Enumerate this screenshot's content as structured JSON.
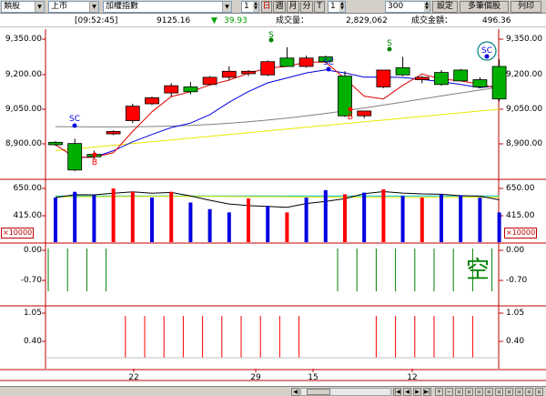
{
  "toolbar": {
    "category": "類股",
    "market": "上市",
    "index_name": "加權指數",
    "period_value": "1",
    "period_buttons": [
      "日",
      "週",
      "月",
      "分",
      "T"
    ],
    "period_active": "日",
    "count_value": "1",
    "bars_value": "300",
    "settings_label": "設定",
    "multi_label": "多筆個股",
    "list_label": "列印"
  },
  "infobar": {
    "time": "[09:52:45]",
    "price": "9125.16",
    "change_arrow": "▼",
    "change": "39.93",
    "volume_label": "成交量：",
    "volume": "2,829,062",
    "amount_label": "成交金額：",
    "amount": "496.36"
  },
  "axes": {
    "price_ticks": [
      "9,350.00",
      "9,200.00",
      "9,050.00",
      "8,900.00"
    ],
    "volume_ticks": [
      "650.00",
      "415.00"
    ],
    "volume_unit": "×10000",
    "osc1_ticks": [
      "0.00",
      "-0.70"
    ],
    "osc2_ticks": [
      "1.05",
      "0.40"
    ],
    "x_ticks": [
      "22",
      "29",
      "15",
      "12"
    ],
    "osc_mark": "空"
  },
  "signals": {
    "sc": "SC",
    "b": "B",
    "s": "S"
  },
  "colors": {
    "up": "#ff0000",
    "down": "#00b000",
    "ma_short": "#e00000",
    "ma_mid": "#0000e0",
    "ma_long": "#808080",
    "ma_yellow": "#e8e800",
    "vol_blue": "#0000e0",
    "vol_red": "#ff0000",
    "axis": "#c00000"
  },
  "chart_data": {
    "type": "candlestick",
    "y_range": [
      8800,
      9420
    ],
    "candles": [
      {
        "o": 8950,
        "h": 8955,
        "l": 8935,
        "c": 8940
      },
      {
        "o": 8945,
        "h": 8965,
        "l": 8830,
        "c": 8835
      },
      {
        "o": 8900,
        "h": 8915,
        "l": 8880,
        "c": 8890
      },
      {
        "o": 8985,
        "h": 9000,
        "l": 8980,
        "c": 8995
      },
      {
        "o": 9040,
        "h": 9110,
        "l": 9030,
        "c": 9100
      },
      {
        "o": 9110,
        "h": 9140,
        "l": 9105,
        "c": 9135
      },
      {
        "o": 9155,
        "h": 9195,
        "l": 9140,
        "c": 9185
      },
      {
        "o": 9180,
        "h": 9200,
        "l": 9150,
        "c": 9160
      },
      {
        "o": 9190,
        "h": 9225,
        "l": 9185,
        "c": 9220
      },
      {
        "o": 9220,
        "h": 9265,
        "l": 9210,
        "c": 9245
      },
      {
        "o": 9235,
        "h": 9250,
        "l": 9225,
        "c": 9245
      },
      {
        "o": 9230,
        "h": 9290,
        "l": 9225,
        "c": 9285
      },
      {
        "o": 9300,
        "h": 9345,
        "l": 9265,
        "c": 9265
      },
      {
        "o": 9265,
        "h": 9310,
        "l": 9260,
        "c": 9300
      },
      {
        "o": 9305,
        "h": 9310,
        "l": 9280,
        "c": 9285
      },
      {
        "o": 9225,
        "h": 9245,
        "l": 9055,
        "c": 9060
      },
      {
        "o": 9060,
        "h": 9080,
        "l": 9050,
        "c": 9080
      },
      {
        "o": 9180,
        "h": 9250,
        "l": 9175,
        "c": 9250
      },
      {
        "o": 9260,
        "h": 9305,
        "l": 9225,
        "c": 9230
      },
      {
        "o": 9210,
        "h": 9225,
        "l": 9195,
        "c": 9220
      },
      {
        "o": 9240,
        "h": 9250,
        "l": 9185,
        "c": 9190
      },
      {
        "o": 9250,
        "h": 9255,
        "l": 9205,
        "c": 9205
      },
      {
        "o": 9210,
        "h": 9220,
        "l": 9175,
        "c": 9180
      },
      {
        "o": 9265,
        "h": 9295,
        "l": 9120,
        "c": 9130
      }
    ],
    "volume_range": [
      0,
      750
    ],
    "volumes": [
      {
        "v": 540,
        "up": false
      },
      {
        "v": 610,
        "up": false
      },
      {
        "v": 570,
        "up": false
      },
      {
        "v": 650,
        "up": true
      },
      {
        "v": 610,
        "up": true
      },
      {
        "v": 540,
        "up": false
      },
      {
        "v": 610,
        "up": true
      },
      {
        "v": 480,
        "up": false
      },
      {
        "v": 400,
        "up": false
      },
      {
        "v": 360,
        "up": false
      },
      {
        "v": 530,
        "up": true
      },
      {
        "v": 440,
        "up": false
      },
      {
        "v": 360,
        "up": true
      },
      {
        "v": 540,
        "up": false
      },
      {
        "v": 630,
        "up": false
      },
      {
        "v": 580,
        "up": true
      },
      {
        "v": 600,
        "up": false
      },
      {
        "v": 640,
        "up": true
      },
      {
        "v": 560,
        "up": false
      },
      {
        "v": 540,
        "up": true
      },
      {
        "v": 580,
        "up": false
      },
      {
        "v": 570,
        "up": false
      },
      {
        "v": 540,
        "up": false
      },
      {
        "v": 360,
        "up": false
      }
    ]
  }
}
